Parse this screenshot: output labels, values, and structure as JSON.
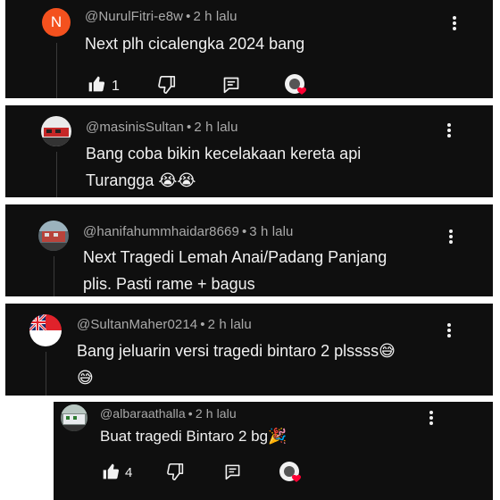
{
  "comments": [
    {
      "handle": "@NurulFitri-e8w",
      "time": "2 h lalu",
      "avatar_letter": "N",
      "avatar_color": "#f4511e",
      "text_lines": [
        "Next plh cicalengka 2024 bang"
      ],
      "likes": "1"
    },
    {
      "handle": "@masinisSultan",
      "time": "2 h lalu",
      "text_lines": [
        "Bang coba bikin kecelakaan kereta api",
        "Turangga 😭😭"
      ]
    },
    {
      "handle": "@hanifahummhaidar8669",
      "time": "3 h lalu",
      "text_lines": [
        "Next Tragedi Lemah Anai/Padang Panjang",
        "plis. Pasti rame + bagus"
      ]
    },
    {
      "handle": "@SultanMaher0214",
      "time": "2 h lalu",
      "text_lines": [
        "Bang jeluarin versi tragedi bintaro 2 plssss😅",
        "😅"
      ]
    },
    {
      "handle": "@albaraathalla",
      "time": "2 h lalu",
      "text_lines": [
        "Buat tragedi Bintaro 2 bg🎉"
      ],
      "likes": "4"
    }
  ],
  "colors": {
    "card_bg": "#0f0f0f",
    "text": "#f1f1f1",
    "meta": "#aaaaaa",
    "heart": "#ff0033"
  },
  "icons": [
    "like-icon",
    "dislike-icon",
    "reply-icon",
    "creator-heart-icon",
    "more-options-icon"
  ]
}
